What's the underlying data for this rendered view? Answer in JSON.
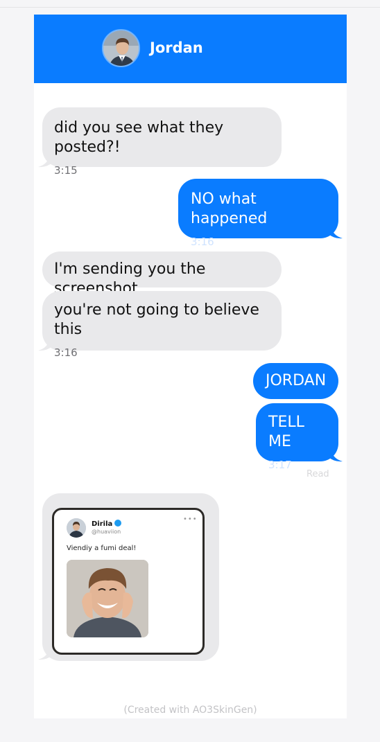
{
  "header": {
    "contact_name": "Jordan",
    "avatar": "contact-avatar",
    "background_color": "#0a7cff"
  },
  "messages": [
    {
      "side": "incoming",
      "text": "did you see what they posted?!",
      "time": "3:15"
    },
    {
      "side": "outgoing",
      "text": "NO what happened",
      "time": "3:16"
    },
    {
      "side": "incoming",
      "text": "I'm sending you the screenshot",
      "time": ""
    },
    {
      "side": "incoming",
      "text": "you're not going to believe this",
      "time": "3:16"
    },
    {
      "side": "outgoing",
      "text": "JORDAN",
      "time": ""
    },
    {
      "side": "outgoing",
      "text": "TELL ME",
      "time": "3:17"
    }
  ],
  "read_receipt": "Read",
  "screenshot_post": {
    "author": "Dirila",
    "handle": "@huaviion",
    "text": "Viendiy a fumi deal!",
    "more": "•••",
    "verified_color": "#1d9bf0"
  },
  "footer": "(Created with AO3SkinGen)",
  "colors": {
    "incoming_bubble": "#e9e9eb",
    "outgoing_bubble": "#0a7cff"
  }
}
